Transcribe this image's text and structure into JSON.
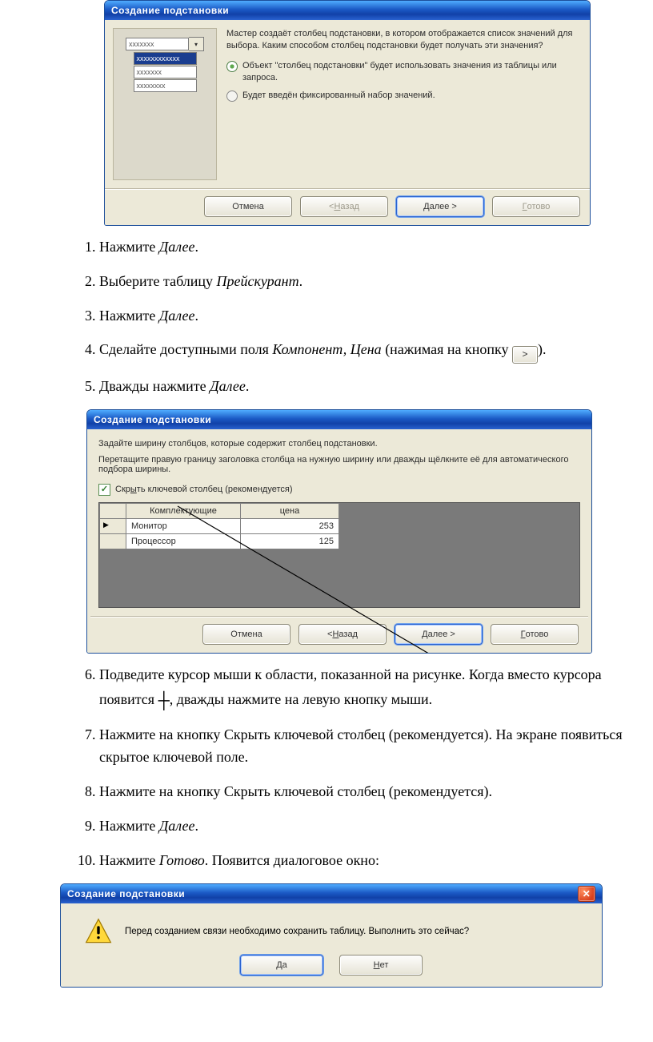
{
  "dlg1": {
    "title": "Создание подстановки",
    "intro": "Мастер создаёт столбец подстановки, в котором отображается список значений для выбора. Каким способом столбец подстановки будет получать эти значения?",
    "opt1": "Объект \"столбец подстановки\" будет использовать значения из таблицы или запроса.",
    "opt2": "Будет введён фиксированный набор значений.",
    "mock_rows": [
      "xxxxxxx",
      "xxxxxxxxxxxx",
      "xxxxxxx",
      "xxxxxxxx"
    ],
    "btn_cancel": "Отмена",
    "btn_back": "< Назад",
    "btn_back_u": "Н",
    "btn_next": "Далее >",
    "btn_next_u": "Д",
    "btn_finish": "Готово",
    "btn_finish_u": "Г"
  },
  "steps15": {
    "s1_a": "Нажмите ",
    "s1_b": "Далее",
    "s1_c": ".",
    "s2_a": "Выберите таблицу ",
    "s2_b": "Прейскурант",
    "s2_c": ".",
    "s3_a": "Нажмите ",
    "s3_b": "Далее",
    "s3_c": ".",
    "s4_a": "Сделайте доступными поля ",
    "s4_b": "Компонент, Цена",
    "s4_c": " (нажимая на кнопку ",
    "s4_d": ").",
    "s5_a": "Дважды нажмите ",
    "s5_b": "Далее",
    "s5_c": "."
  },
  "move_btn_label": ">",
  "dlg2": {
    "title": "Создание подстановки",
    "p1": "Задайте ширину столбцов, которые содержит столбец подстановки.",
    "p2": "Перетащите правую границу заголовка столбца на нужную ширину или дважды щёлкните её для автоматического подбора ширины.",
    "chk_label": "Скрыть ключевой столбец (рекомендуется)",
    "chk_u": "ы",
    "hdr1": "Комплектующие",
    "hdr2": "цена",
    "rows": [
      {
        "c1": "Монитор",
        "c2": "253"
      },
      {
        "c1": "Процессор",
        "c2": "125"
      }
    ],
    "btn_cancel": "Отмена",
    "btn_back": "< Назад",
    "btn_back_u": "Н",
    "btn_next": "Далее >",
    "btn_next_u": "Д",
    "btn_finish": "Готово",
    "btn_finish_u": "Г"
  },
  "steps610": {
    "s6": "Подведите курсор мыши к области, показанной на рисунке.   Когда вместо курсора появится  ",
    "s6b": ", дважды нажмите на левую кнопку мыши.",
    "s7": "Нажмите на кнопку Скрыть ключевой столбец (рекомендуется). На экране появиться скрытое ключевой поле.",
    "s8": "Нажмите на кнопку Скрыть ключевой столбец (рекомендуется).",
    "s9_a": "Нажмите ",
    "s9_b": "Далее",
    "s9_c": ".",
    "s10_a": "Нажмите ",
    "s10_b": "Готово",
    "s10_c": ". Появится диалоговое окно:"
  },
  "plus_sign": "┼",
  "dlg3": {
    "title": "Создание подстановки",
    "msg": "Перед созданием связи необходимо сохранить таблицу.  Выполнить это сейчас?",
    "yes": "Да",
    "yes_u": "Д",
    "no": "Нет",
    "no_u": "Н"
  }
}
